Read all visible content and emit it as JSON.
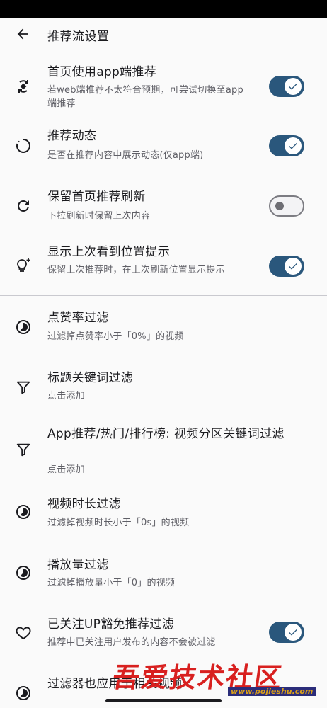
{
  "app_bar": {
    "title": "推荐流设置",
    "back_icon": "arrow-back-icon"
  },
  "colors": {
    "accent": "#2a577c",
    "watermark": "#d8201f"
  },
  "items": [
    {
      "title": "首页使用app端推荐",
      "subtitle": "若web端推荐不太符合预期，可尝试切换至app端推荐",
      "icon": "sync-arrows-icon",
      "toggle": "on"
    },
    {
      "title": "推荐动态",
      "subtitle": "是否在推荐内容中展示动态(仅app端)",
      "icon": "loading-circle-icon",
      "toggle": "on"
    },
    {
      "title": "保留首页推荐刷新",
      "subtitle": "下拉刷新时保留上次内容",
      "icon": "refresh-icon",
      "toggle": "off"
    },
    {
      "title": "显示上次看到位置提示",
      "subtitle": "保留上次推荐时，在上次刷新位置显示提示",
      "icon": "lightbulb-sparkle-icon",
      "toggle": "on"
    },
    {
      "title": "点赞率过滤",
      "subtitle": "过滤掉点赞率小于「0%」的视频",
      "icon": "pie-chart-icon"
    },
    {
      "title": "标题关键词过滤",
      "subtitle": "点击添加",
      "icon": "filter-icon"
    },
    {
      "title": "App推荐/热门/排行榜: 视频分区关键词过滤",
      "subtitle": "点击添加",
      "icon": "filter-icon"
    },
    {
      "title": "视频时长过滤",
      "subtitle": "过滤掉视频时长小于「0s」的视频",
      "icon": "pie-chart-icon"
    },
    {
      "title": "播放量过滤",
      "subtitle": "过滤掉播放量小于「0」的视频",
      "icon": "pie-chart-icon"
    },
    {
      "title": "已关注UP豁免推荐过滤",
      "subtitle": "推荐中已关注用户发布的内容不会被过滤",
      "icon": "heart-outline-icon",
      "toggle": "on"
    },
    {
      "title": "过滤器也应用于相关视频",
      "icon": "pie-chart-icon"
    }
  ],
  "watermark": {
    "text": "吾爱技术社区",
    "url": "www.pojieshu.com"
  }
}
